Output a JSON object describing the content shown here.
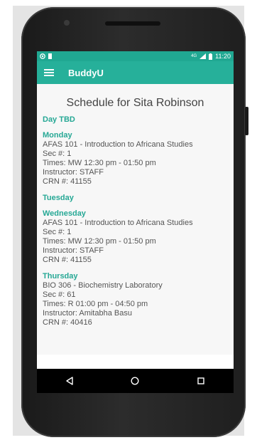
{
  "status_bar": {
    "time": "11:20",
    "signal_label": "4G"
  },
  "app_bar": {
    "title": "BuddyU"
  },
  "page_title": "Schedule for Sita Robinson",
  "days": [
    {
      "label": "Day TBD",
      "lines": []
    },
    {
      "label": "Monday",
      "lines": [
        "AFAS 101 - Introduction to Africana Studies",
        "Sec #: 1",
        "Times: MW 12:30 pm - 01:50 pm",
        "Instructor: STAFF",
        "CRN #: 41155"
      ]
    },
    {
      "label": "Tuesday",
      "lines": []
    },
    {
      "label": "Wednesday",
      "lines": [
        "AFAS 101 - Introduction to Africana Studies",
        "Sec #: 1",
        "Times: MW 12:30 pm - 01:50 pm",
        "Instructor: STAFF",
        "CRN #: 41155"
      ]
    },
    {
      "label": "Thursday",
      "lines": [
        "BIO 306 - Biochemistry Laboratory",
        "Sec #: 61",
        "Times: R 01:00 pm - 04:50 pm",
        "Instructor: Amitabha Basu",
        "CRN #: 40416"
      ]
    }
  ],
  "colors": {
    "accent": "#26b09a",
    "status_bar": "#20a892",
    "day_label": "#26a895"
  }
}
